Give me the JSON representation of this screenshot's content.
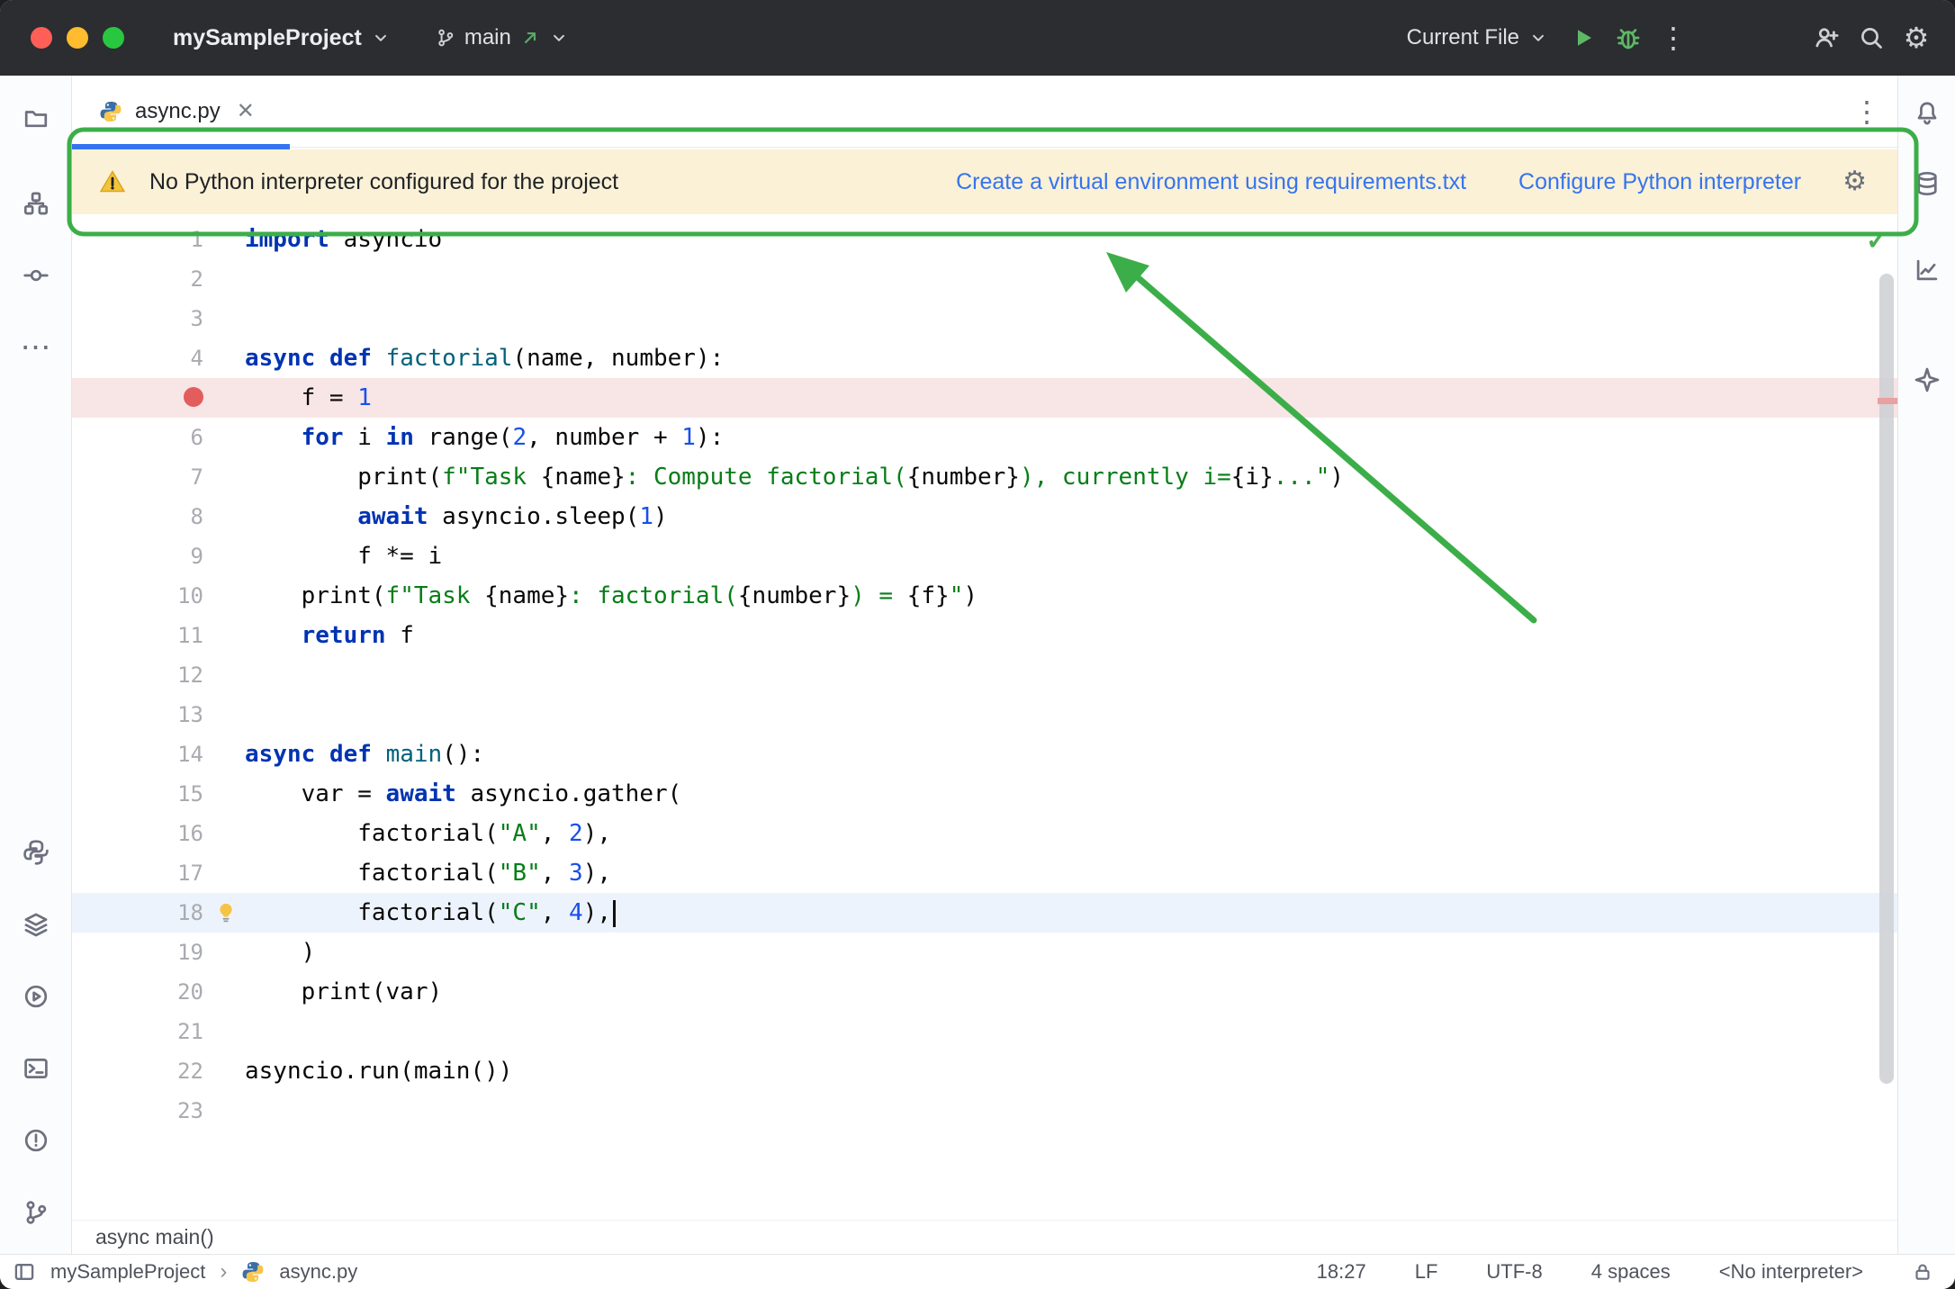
{
  "titlebar": {
    "project": "mySampleProject",
    "branch": "main",
    "run_config": "Current File"
  },
  "tab": {
    "label": "async.py"
  },
  "banner": {
    "message": "No Python interpreter configured for the project",
    "link_venv": "Create a virtual environment using requirements.txt",
    "link_configure": "Configure Python interpreter"
  },
  "editor": {
    "breadcrumb": "async main()",
    "lines": [
      {
        "n": 1,
        "t": [
          [
            "kw",
            "import"
          ],
          [
            "pl",
            " asyncio"
          ]
        ]
      },
      {
        "n": 2,
        "t": []
      },
      {
        "n": 3,
        "t": []
      },
      {
        "n": 4,
        "t": [
          [
            "kw",
            "async"
          ],
          [
            "pl",
            " "
          ],
          [
            "kw",
            "def"
          ],
          [
            "pl",
            " "
          ],
          [
            "fn",
            "factorial"
          ],
          [
            "pl",
            "(name, number):"
          ]
        ]
      },
      {
        "n": 5,
        "bp": true,
        "t": [
          [
            "pl",
            "    f = "
          ],
          [
            "num",
            "1"
          ]
        ]
      },
      {
        "n": 6,
        "t": [
          [
            "pl",
            "    "
          ],
          [
            "kw",
            "for"
          ],
          [
            "pl",
            " i "
          ],
          [
            "kw",
            "in"
          ],
          [
            "pl",
            " range("
          ],
          [
            "num",
            "2"
          ],
          [
            "pl",
            ", number + "
          ],
          [
            "num",
            "1"
          ],
          [
            "pl",
            "):"
          ]
        ]
      },
      {
        "n": 7,
        "t": [
          [
            "pl",
            "        print("
          ],
          [
            "str",
            "f\"Task "
          ],
          [
            "pl",
            "{name}"
          ],
          [
            "str",
            ": Compute factorial("
          ],
          [
            "pl",
            "{number}"
          ],
          [
            "str",
            "), currently i="
          ],
          [
            "pl",
            "{i}"
          ],
          [
            "str",
            "...\""
          ],
          [
            "pl",
            ")"
          ]
        ]
      },
      {
        "n": 8,
        "t": [
          [
            "pl",
            "        "
          ],
          [
            "kw",
            "await"
          ],
          [
            "pl",
            " asyncio.sleep("
          ],
          [
            "num",
            "1"
          ],
          [
            "pl",
            ")"
          ]
        ]
      },
      {
        "n": 9,
        "t": [
          [
            "pl",
            "        f *= i"
          ]
        ]
      },
      {
        "n": 10,
        "t": [
          [
            "pl",
            "    print("
          ],
          [
            "str",
            "f\"Task "
          ],
          [
            "pl",
            "{name}"
          ],
          [
            "str",
            ": factorial("
          ],
          [
            "pl",
            "{number}"
          ],
          [
            "str",
            ") = "
          ],
          [
            "pl",
            "{f}"
          ],
          [
            "str",
            "\""
          ],
          [
            "pl",
            ")"
          ]
        ]
      },
      {
        "n": 11,
        "t": [
          [
            "pl",
            "    "
          ],
          [
            "kw",
            "return"
          ],
          [
            "pl",
            " f"
          ]
        ]
      },
      {
        "n": 12,
        "t": []
      },
      {
        "n": 13,
        "t": []
      },
      {
        "n": 14,
        "t": [
          [
            "kw",
            "async"
          ],
          [
            "pl",
            " "
          ],
          [
            "kw",
            "def"
          ],
          [
            "pl",
            " "
          ],
          [
            "fn",
            "main"
          ],
          [
            "pl",
            "():"
          ]
        ]
      },
      {
        "n": 15,
        "t": [
          [
            "pl",
            "    var = "
          ],
          [
            "kw",
            "await"
          ],
          [
            "pl",
            " asyncio.gather("
          ]
        ]
      },
      {
        "n": 16,
        "t": [
          [
            "pl",
            "        factorial("
          ],
          [
            "str",
            "\"A\""
          ],
          [
            "pl",
            ", "
          ],
          [
            "num",
            "2"
          ],
          [
            "pl",
            "),"
          ]
        ]
      },
      {
        "n": 17,
        "t": [
          [
            "pl",
            "        factorial("
          ],
          [
            "str",
            "\"B\""
          ],
          [
            "pl",
            ", "
          ],
          [
            "num",
            "3"
          ],
          [
            "pl",
            "),"
          ]
        ]
      },
      {
        "n": 18,
        "cur": true,
        "bulb": true,
        "caret": true,
        "t": [
          [
            "pl",
            "        factorial("
          ],
          [
            "str",
            "\"C\""
          ],
          [
            "pl",
            ", "
          ],
          [
            "num",
            "4"
          ],
          [
            "pl",
            "),"
          ]
        ]
      },
      {
        "n": 19,
        "t": [
          [
            "pl",
            "    )"
          ]
        ]
      },
      {
        "n": 20,
        "t": [
          [
            "pl",
            "    print(var)"
          ]
        ]
      },
      {
        "n": 21,
        "t": []
      },
      {
        "n": 22,
        "t": [
          [
            "pl",
            "asyncio.run(main())"
          ]
        ]
      },
      {
        "n": 23,
        "t": []
      }
    ]
  },
  "statusbar": {
    "project": "mySampleProject",
    "file": "async.py",
    "position": "18:27",
    "line_separator": "LF",
    "encoding": "UTF-8",
    "indent": "4 spaces",
    "interpreter": "<No interpreter>"
  },
  "icons": {
    "gear": "⚙",
    "close": "✕",
    "more_vert": "⋮",
    "more_horiz": "⋯",
    "check": "✓",
    "crumb_sep": "›"
  },
  "colors": {
    "annotation_green": "#3cae49",
    "link_blue": "#3574f0",
    "banner_bg": "#fbf1d6",
    "keyword": "#0033b3",
    "string": "#067d17",
    "number": "#1750eb",
    "breakpoint": "#e35d5d",
    "titlebar_bg": "#2b2d31"
  }
}
